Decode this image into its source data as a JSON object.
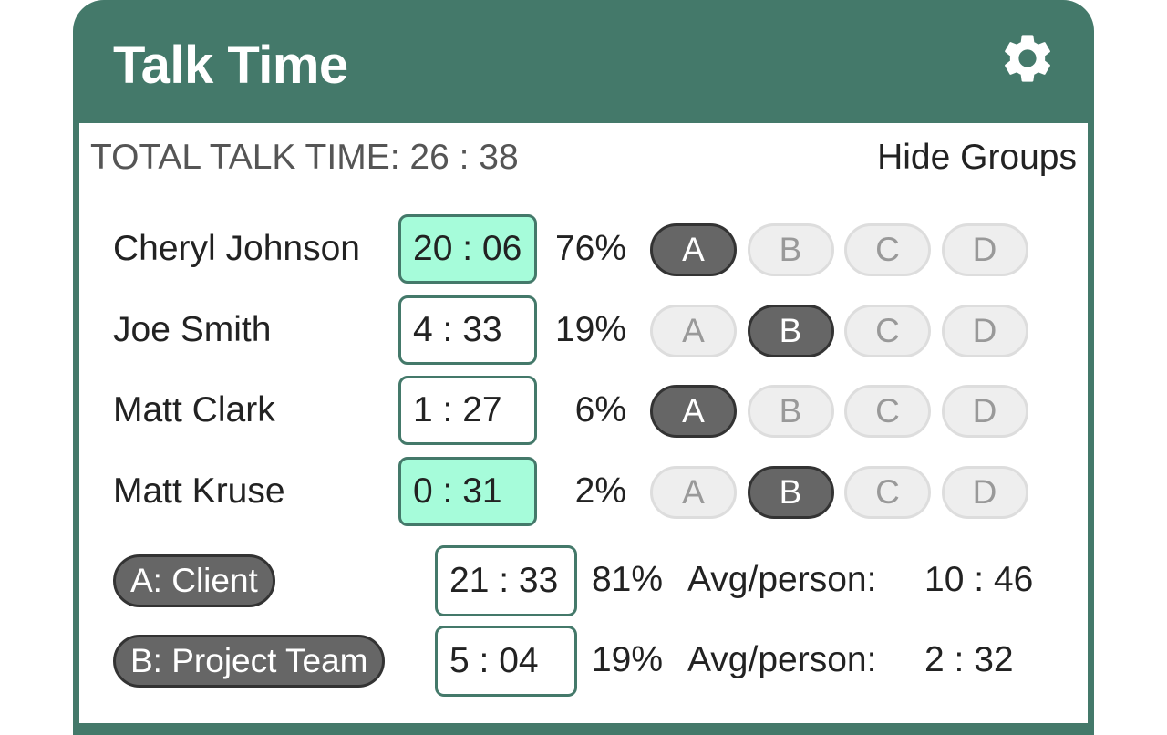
{
  "header": {
    "title": "Talk Time",
    "settings_icon": "gear-icon"
  },
  "summary": {
    "total_label": "TOTAL TALK TIME:",
    "total_value": "26 : 38",
    "toggle_groups_label": "Hide Groups"
  },
  "group_letters": [
    "A",
    "B",
    "C",
    "D"
  ],
  "participants": [
    {
      "name": "Cheryl Johnson",
      "time": "20 : 06",
      "percent": "76%",
      "highlighted": true,
      "group": "A"
    },
    {
      "name": "Joe Smith",
      "time": "4 : 33",
      "percent": "19%",
      "highlighted": false,
      "group": "B"
    },
    {
      "name": "Matt Clark",
      "time": "1 : 27",
      "percent": "6%",
      "highlighted": false,
      "group": "A"
    },
    {
      "name": "Matt Kruse",
      "time": "0 : 31",
      "percent": "2%",
      "highlighted": true,
      "group": "B"
    }
  ],
  "groups": [
    {
      "label": "A: Client",
      "time": "21 : 33",
      "percent": "81%",
      "avg_label": "Avg/person:",
      "avg_value": "10 : 46"
    },
    {
      "label": "B: Project Team",
      "time": "5 : 04",
      "percent": "19%",
      "avg_label": "Avg/person:",
      "avg_value": "2 : 32"
    }
  ],
  "colors": {
    "brand": "#44796a",
    "active_time_bg": "#a6fcda",
    "group_on": "#666666",
    "group_off": "#eeeeee"
  }
}
